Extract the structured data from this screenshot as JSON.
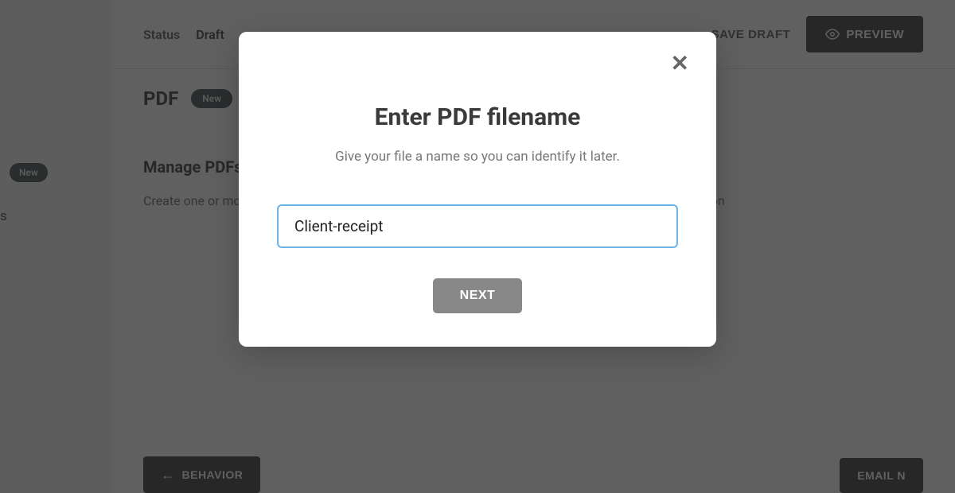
{
  "topbar": {
    "status_label": "Status",
    "status_value": "Draft",
    "save_draft": "SAVE DRAFT",
    "preview": "PREVIEW"
  },
  "sidebar": {
    "new_badge": "New",
    "partial_text": "s"
  },
  "content": {
    "pdf_title": "PDF",
    "pdf_badge": "New",
    "manage_title": "Manage PDFs",
    "manage_desc": "Create one or more templates that . When you do, you'll be able to view and populated form submission"
  },
  "bottom": {
    "behavior": "BEHAVIOR",
    "email": "EMAIL N"
  },
  "modal": {
    "title": "Enter PDF filename",
    "subtitle": "Give your file a name so you can identify it later.",
    "input_value": "Client-receipt",
    "next": "NEXT"
  }
}
